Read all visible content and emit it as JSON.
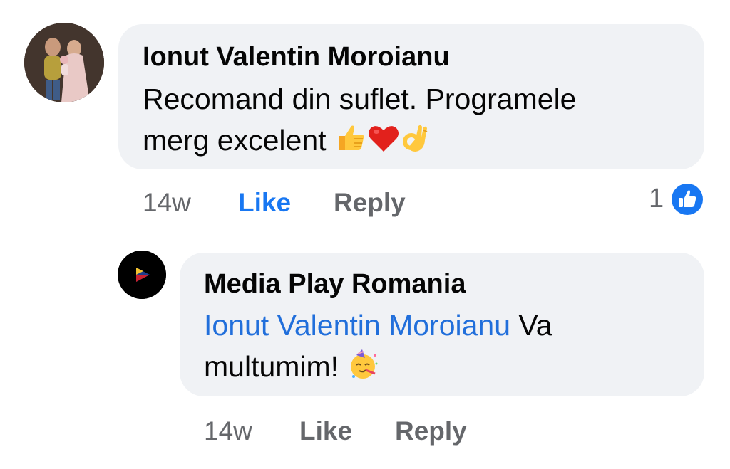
{
  "comment": {
    "author": "Ionut Valentin Moroianu",
    "text_line1": "Recomand din suflet. Programele",
    "text_line2": "merg excelent",
    "emojis": [
      "thumbs-up",
      "red-heart",
      "ok-hand"
    ],
    "time": "14w",
    "like_label": "Like",
    "reply_label": "Reply",
    "reaction_count": "1",
    "reaction_icon": "like-reaction-icon"
  },
  "reply": {
    "author": "Media Play Romania",
    "mention": "Ionut Valentin Moroianu",
    "text_after_mention": " Va",
    "text_line2": "multumim!",
    "emojis": [
      "partying-face"
    ],
    "time": "14w",
    "like_label": "Like",
    "reply_label": "Reply"
  },
  "colors": {
    "bubble": "#f0f2f5",
    "link": "#216fdb",
    "like_active": "#1877f2",
    "meta": "#65676b"
  }
}
